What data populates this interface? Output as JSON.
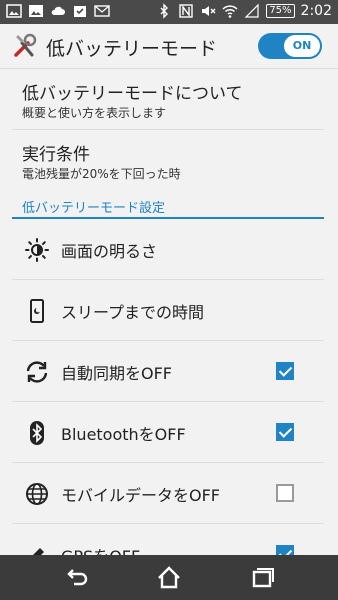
{
  "status_bar": {
    "battery": "75%",
    "time": "2:02"
  },
  "header": {
    "title": "低バッテリーモード",
    "toggle_label": "ON",
    "toggle_state": true
  },
  "info_items": [
    {
      "title": "低バッテリーモードについて",
      "subtitle": "概要と使い方を表示します"
    },
    {
      "title": "実行条件",
      "subtitle": "電池残量が20%を下回った時"
    }
  ],
  "section_title": "低バッテリーモード設定",
  "settings": [
    {
      "label": "画面の明るさ",
      "icon": "brightness-icon"
    },
    {
      "label": "スリープまでの時間",
      "icon": "sleep-phone-icon"
    },
    {
      "label": "自動同期をOFF",
      "icon": "sync-icon",
      "checked": true
    },
    {
      "label": "BluetoothをOFF",
      "icon": "bluetooth-icon",
      "checked": true
    },
    {
      "label": "モバイルデータをOFF",
      "icon": "globe-icon",
      "checked": false
    },
    {
      "label": "GPSをOFF",
      "icon": "gps-icon",
      "checked": true
    }
  ],
  "colors": {
    "accent": "#1f83c4",
    "statusbar": "#4a4a4a",
    "navbar": "#3b3b3b"
  }
}
